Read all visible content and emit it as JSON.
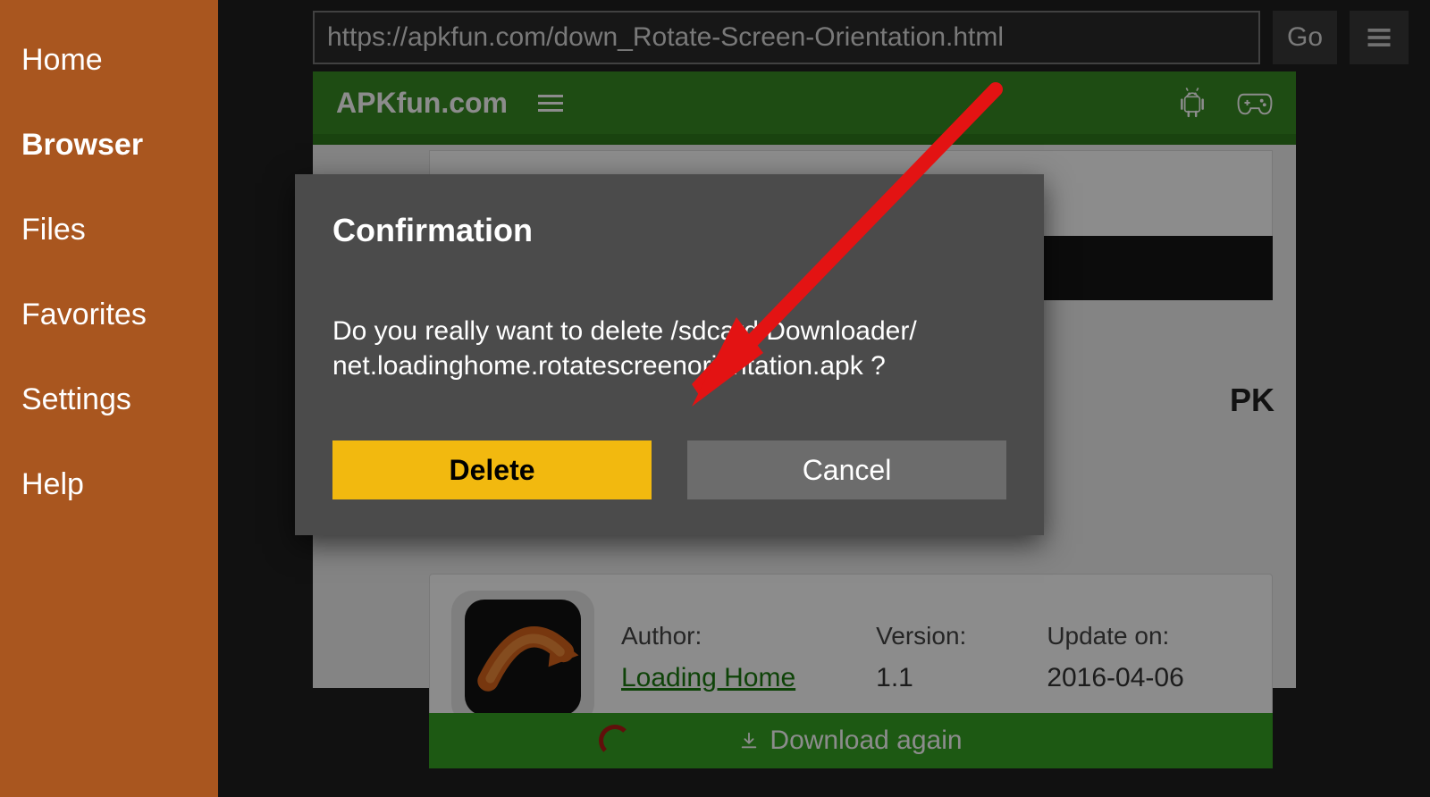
{
  "sidebar": {
    "items": [
      {
        "label": "Home"
      },
      {
        "label": "Browser"
      },
      {
        "label": "Files"
      },
      {
        "label": "Favorites"
      },
      {
        "label": "Settings"
      },
      {
        "label": "Help"
      }
    ],
    "active_index": 1
  },
  "urlbar": {
    "value": "https://apkfun.com/down_Rotate-Screen-Orientation.html",
    "go_label": "Go"
  },
  "site": {
    "title": "APKfun.com"
  },
  "page": {
    "apk_heading_suffix": "PK",
    "author_label": "Author:",
    "author_value": "Loading Home",
    "version_label": "Version:",
    "version_value": "1.1",
    "update_label": "Update on:",
    "update_value": "2016-04-06",
    "download_again_label": "Download again"
  },
  "dialog": {
    "title": "Confirmation",
    "message": "Do you really want to delete /sdcard/Downloader/\nnet.loadinghome.rotatescreenorientation.apk ?",
    "delete_label": "Delete",
    "cancel_label": "Cancel"
  }
}
